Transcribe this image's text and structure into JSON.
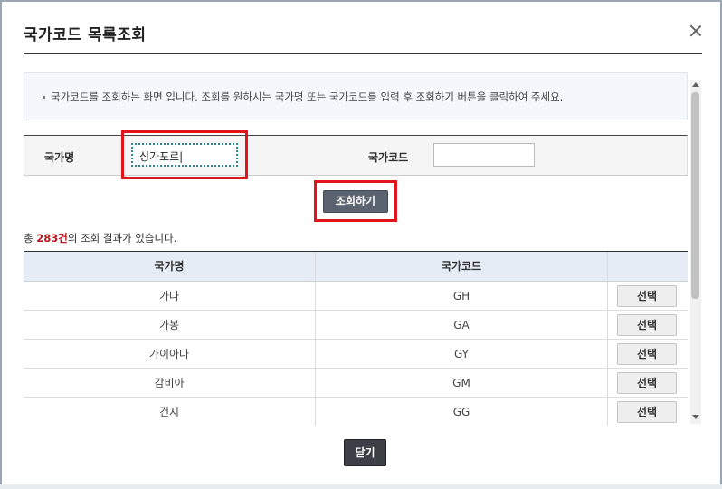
{
  "dialog": {
    "title": "국가코드 목록조회"
  },
  "notice": {
    "text": "국가코드를 조회하는 화면 입니다. 조회를 원하시는 국가명 또는 국가코드를 입력 후 조회하기 버튼을 클릭하여 주세요."
  },
  "search": {
    "country_name_label": "국가명",
    "country_name_value": "싱가포르|",
    "country_code_label": "국가코드",
    "country_code_value": "",
    "button_label": "조회하기"
  },
  "result": {
    "prefix": "총 ",
    "count": "283건",
    "suffix": "의 조회 결과가 있습니다."
  },
  "table": {
    "headers": [
      "국가명",
      "국가코드",
      ""
    ],
    "rows": [
      {
        "name": "가나",
        "code": "GH",
        "action": "선택"
      },
      {
        "name": "가봉",
        "code": "GA",
        "action": "선택"
      },
      {
        "name": "가이아나",
        "code": "GY",
        "action": "선택"
      },
      {
        "name": "감비아",
        "code": "GM",
        "action": "선택"
      },
      {
        "name": "건지",
        "code": "GG",
        "action": "선택"
      }
    ]
  },
  "footer": {
    "close_label": "닫기"
  },
  "colors": {
    "highlight": "#e0141b",
    "count_accent": "#c0121a",
    "header_bg": "#e5ecf5",
    "search_button_bg": "#5b6370"
  }
}
